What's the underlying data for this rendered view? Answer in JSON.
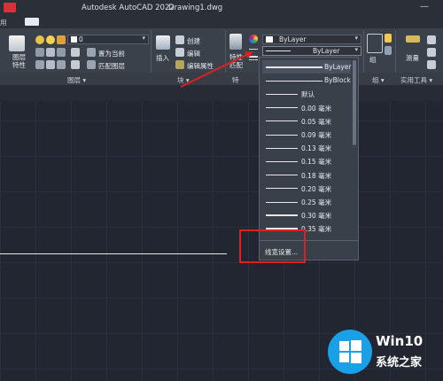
{
  "titlebar": {
    "app_title": "Autodesk AutoCAD 2022",
    "document": "Drawing1.dwg",
    "minimize": "—"
  },
  "tabs": {
    "partial_tab": "用"
  },
  "ribbon": {
    "layers": {
      "label": "图层\n特性",
      "layer_value": "0",
      "panel_title": "图层 ▾"
    },
    "block": {
      "insert_label": "插入",
      "create": "创建",
      "edit": "编辑",
      "edit_attr": "编辑属性",
      "panel_title": "块 ▾"
    },
    "properties": {
      "match_label": "特性\n匹配",
      "color_value": "ByLayer",
      "lineweight_value": "ByLayer",
      "panel_title": "特"
    },
    "group": {
      "label": "组",
      "panel_title": "组 ▾"
    },
    "utilities": {
      "measure_label": "测量",
      "panel_title": "实用工具 ▾"
    },
    "layer_buttons": {
      "set_current": "置为当前",
      "match_layer": "匹配图层"
    }
  },
  "lineweight_menu": {
    "items": [
      {
        "label": "ByLayer",
        "weight": 2,
        "selected": true
      },
      {
        "label": "ByBlock",
        "weight": 1,
        "selected": false
      },
      {
        "label": "默认",
        "weight": 0,
        "selected": false
      },
      {
        "label": "0.00 毫米",
        "weight": 1,
        "selected": false
      },
      {
        "label": "0.05 毫米",
        "weight": 1,
        "selected": false
      },
      {
        "label": "0.09 毫米",
        "weight": 1,
        "selected": false
      },
      {
        "label": "0.13 毫米",
        "weight": 1,
        "selected": false
      },
      {
        "label": "0.15 毫米",
        "weight": 1,
        "selected": false
      },
      {
        "label": "0.18 毫米",
        "weight": 1,
        "selected": false
      },
      {
        "label": "0.20 毫米",
        "weight": 1,
        "selected": false
      },
      {
        "label": "0.25 毫米",
        "weight": 1,
        "selected": false
      },
      {
        "label": "0.30 毫米",
        "weight": 2,
        "selected": false
      },
      {
        "label": "0.35 毫米",
        "weight": 3,
        "selected": false
      }
    ],
    "footer": "线宽设置..."
  },
  "watermark": {
    "brand": "Win10",
    "sub": "系统之家"
  },
  "colors": {
    "accent_red": "#e02020",
    "ribbon_bg": "#3b414b",
    "canvas_bg": "#212631"
  }
}
